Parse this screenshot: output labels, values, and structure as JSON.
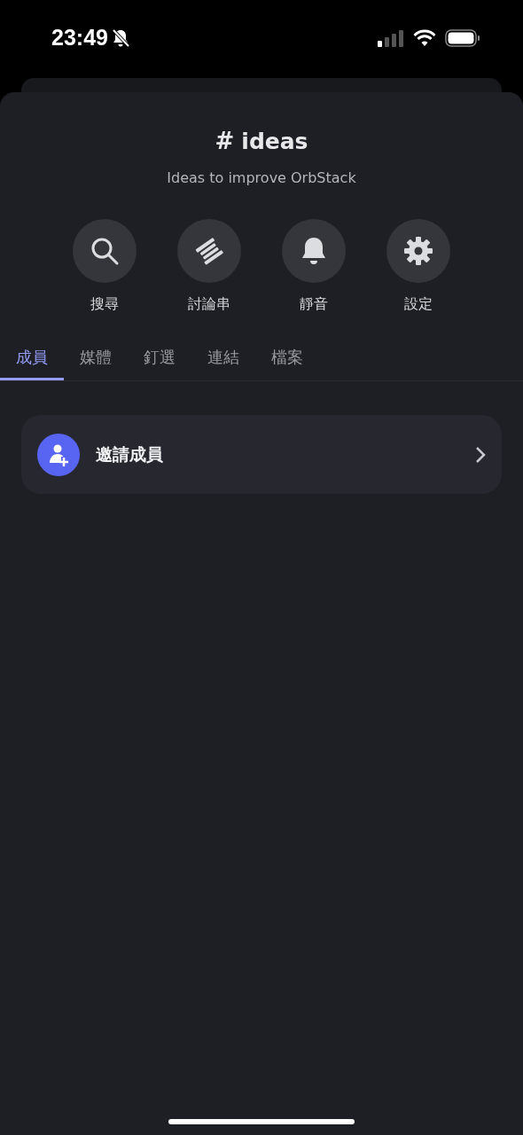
{
  "status_bar": {
    "time": "23:49",
    "silent": true
  },
  "channel": {
    "hash": "#",
    "name": "ideas",
    "topic": "Ideas to improve OrbStack"
  },
  "actions": [
    {
      "kind": "search",
      "label": "搜尋"
    },
    {
      "kind": "threads",
      "label": "討論串"
    },
    {
      "kind": "bell",
      "label": "靜音"
    },
    {
      "kind": "gear",
      "label": "設定"
    }
  ],
  "tabs": [
    {
      "label": "成員",
      "selected": true
    },
    {
      "label": "媒體",
      "selected": false
    },
    {
      "label": "釘選",
      "selected": false
    },
    {
      "label": "連結",
      "selected": false
    },
    {
      "label": "檔案",
      "selected": false
    }
  ],
  "invite": {
    "label": "邀請成員"
  }
}
